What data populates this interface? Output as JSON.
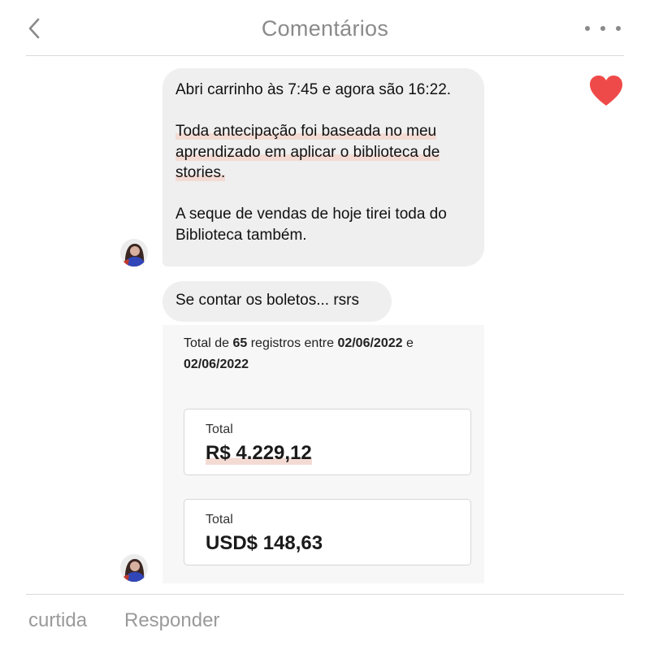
{
  "header": {
    "title": "Comentários",
    "back_icon": "chevron-left-icon",
    "more_icon": "more-horizontal-icon"
  },
  "comment": {
    "liked": true,
    "like_color": "#ef4a4a",
    "message_1": {
      "line_1": "Abri carrinho às 7:45 e agora são 16:22.",
      "paragraph_2_lines": [
        "Toda antecipação foi baseada no meu",
        "aprendizado em aplicar o biblioteca de",
        "stories."
      ],
      "paragraph_3_lines": [
        "A seque de vendas de hoje tirei toda do",
        "Biblioteca também."
      ]
    },
    "message_2": "Se contar os boletos... rsrs",
    "attachment": {
      "summary_prefix": "Total de ",
      "count": "65",
      "summary_middle": " registros entre ",
      "date_start": "02/06/2022",
      "summary_and": " e",
      "date_end": "02/06/2022",
      "cards": [
        {
          "label": "Total",
          "value": "R$ 4.229,12"
        },
        {
          "label": "Total",
          "value": "USD$ 148,63"
        }
      ]
    }
  },
  "footer": {
    "like_label": "curtida",
    "reply_label": "Responder"
  }
}
